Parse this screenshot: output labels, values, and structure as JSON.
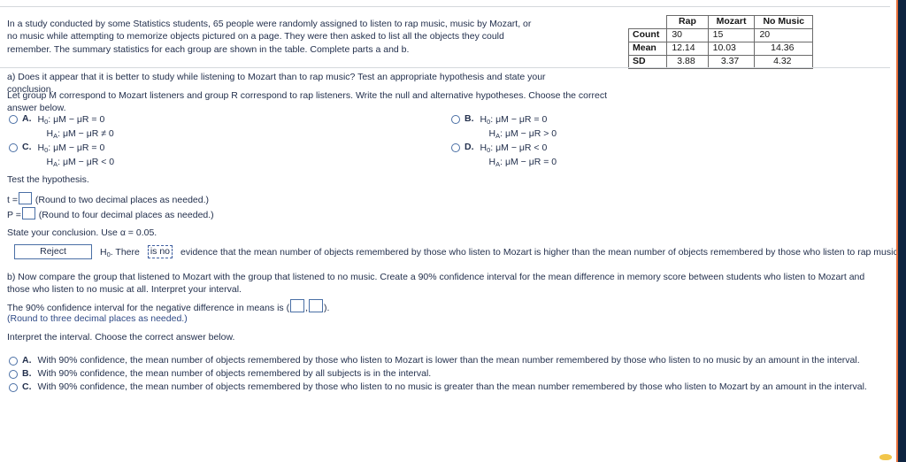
{
  "intro": {
    "text": "In a study conducted by some Statistics students, 65 people were randomly assigned to listen to rap music, music by Mozart, or no music while attempting to memorize objects pictured on a page. They were then asked to list all the objects they could remember. The summary statistics for each group are shown in the table. Complete parts a and b."
  },
  "summary_table": {
    "columns": [
      "Rap",
      "Mozart",
      "No Music"
    ],
    "rows": [
      {
        "label": "Count",
        "values": [
          "30",
          "15",
          "20"
        ]
      },
      {
        "label": "Mean",
        "values": [
          "12.14",
          "10.03",
          "14.36"
        ]
      },
      {
        "label": "SD",
        "values": [
          "3.88",
          "3.37",
          "4.32"
        ]
      }
    ]
  },
  "part_a": {
    "question": "a) Does it appear that it is better to study while listening to Mozart than to rap music? Test an appropriate hypothesis and state your conclusion.",
    "instruction": "Let group M correspond to Mozart listeners and group R correspond to rap listeners. Write the null and alternative hypotheses. Choose the correct answer below.",
    "options": [
      {
        "letter": "A.",
        "null": "H",
        "null_sub": "0",
        "line1_rest": ": μM − μR = 0",
        "line2_rest": ": μM − μR ≠ 0"
      },
      {
        "letter": "B.",
        "line1_rest": ": μM − μR = 0",
        "line2_rest": ": μM − μR > 0"
      },
      {
        "letter": "C.",
        "line1_rest": ": μM − μR = 0",
        "line2_rest": ": μM − μR < 0"
      },
      {
        "letter": "D.",
        "line1_rest": ": μM − μR < 0",
        "line2_rest": ": μM − μR = 0"
      }
    ],
    "test_heading": "Test the hypothesis.",
    "t_label": "t =",
    "t_value": "",
    "t_hint": "(Round to two decimal places as needed.)",
    "p_label": "P =",
    "p_value": "",
    "p_hint": "(Round to four decimal places as needed.)",
    "conclusion_prompt": "State your conclusion. Use α = 0.05.",
    "conclusion": {
      "decision_value": "Reject",
      "after_decision": ". There",
      "evidence_value": "is no",
      "tail": "evidence that the mean number of objects remembered by those who listen to Mozart is higher than the mean number of objects remembered by those who listen to rap music."
    }
  },
  "part_b": {
    "question": "b) Now compare the group that listened to Mozart with the group that listened to no music. Create a 90% confidence interval for the mean difference in memory score between students who listen to Mozart and those who listen to no music at all. Interpret your interval.",
    "ci_prefix": "The 90% confidence interval for the negative difference in means is (",
    "ci_sep": ",",
    "ci_suffix": ").",
    "ci_lower": "",
    "ci_upper": "",
    "ci_hint": "(Round to three decimal places as needed.)",
    "interpret_prompt": "Interpret the interval. Choose the correct answer below.",
    "options": [
      {
        "letter": "A.",
        "text": "With 90% confidence, the mean number of objects remembered by those who listen to Mozart is lower than the mean number remembered by those who listen to no music by an amount in the interval."
      },
      {
        "letter": "B.",
        "text": "With 90% confidence, the mean number of objects remembered by all subjects is in the interval."
      },
      {
        "letter": "C.",
        "text": "With 90% confidence, the mean number of objects remembered by those who listen to no music is greater than the mean number remembered by those who listen to Mozart by an amount in the interval."
      }
    ]
  }
}
